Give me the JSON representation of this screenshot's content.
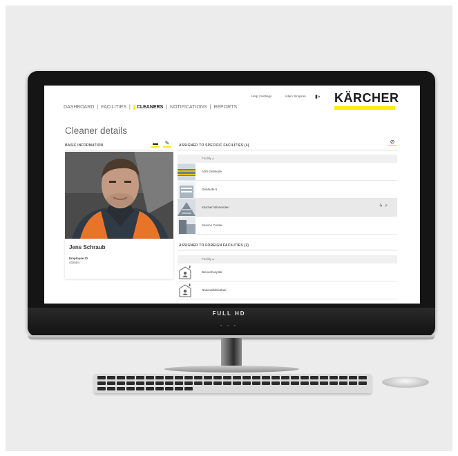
{
  "header": {
    "nav": [
      "DASHBOARD",
      "FACILITIES",
      "CLEANERS",
      "NOTIFICATIONS",
      "REPORTS"
    ],
    "nav_separator": "|",
    "active_nav_index": 2,
    "help_link": "Help | Settings",
    "user_name": "Adam Simpson",
    "logo_text": "KÄRCHER"
  },
  "page": {
    "title": "Cleaner details"
  },
  "basic_info": {
    "heading": "BASIC INFORMATION",
    "cleaner_name": "Jens Schraub",
    "employee_id_label": "Employee ID",
    "employee_id": "402584"
  },
  "specific_facilities": {
    "heading": "ASSIGNED TO SPECIFIC FACILITIES (4)",
    "column_header": "Facility ▴",
    "rows": [
      "ADS Gebäude",
      "Gebäude 5",
      "Kärcher Winnenden",
      "Service Center"
    ],
    "highlighted_row_index": 2
  },
  "foreign_facilities": {
    "heading": "ASSIGNED TO FOREIGN FACILITIES (2)",
    "column_header": "Facility ▴",
    "rows": [
      "Bienenhospital",
      "Nationalbibliothek"
    ]
  },
  "monitor": {
    "label": "FULL HD",
    "dots": "• • •"
  },
  "colors": {
    "accent": "#ffed00",
    "logo_text": "#1b1b1b",
    "bezel": "#151515"
  },
  "icons": [
    "user-icon",
    "id-card-icon",
    "pencil-icon",
    "link-icon",
    "unassign-icon",
    "search-icon",
    "facility-person-icon"
  ]
}
